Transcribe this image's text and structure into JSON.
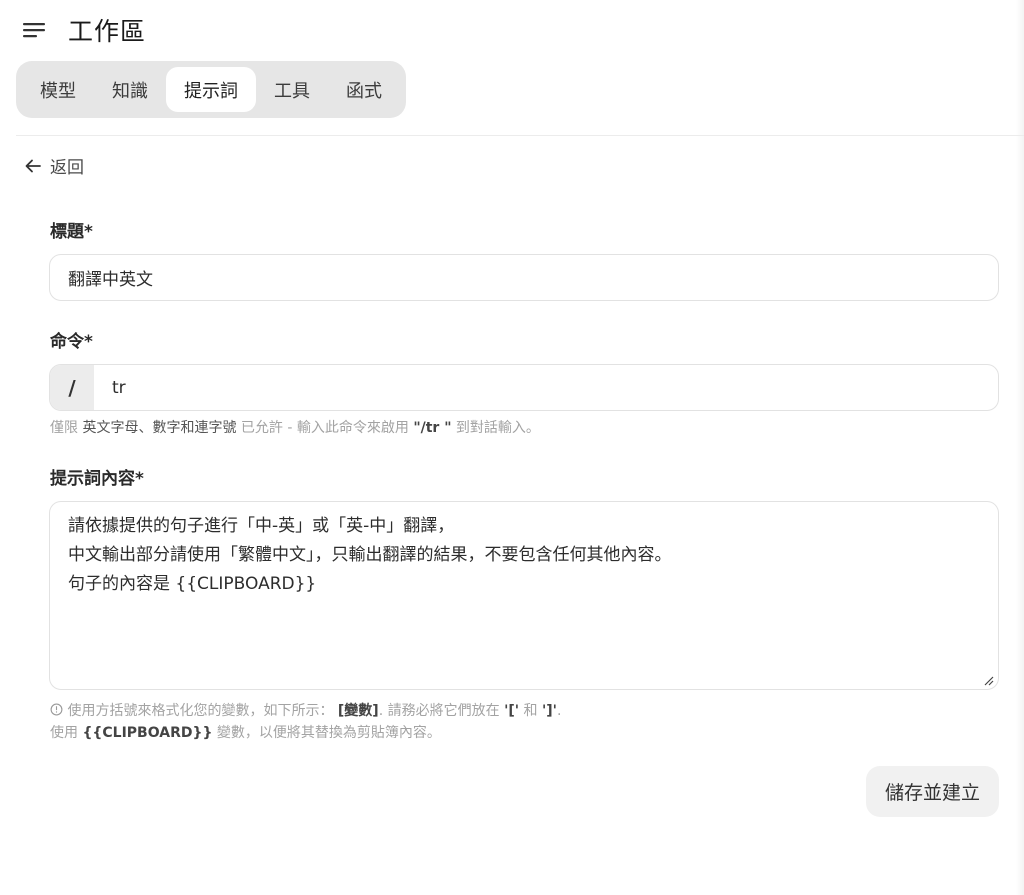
{
  "header": {
    "title": "工作區",
    "menu_icon": "hamburger-menu-icon"
  },
  "tabs": [
    {
      "label": "模型",
      "active": false
    },
    {
      "label": "知識",
      "active": false
    },
    {
      "label": "提示詞",
      "active": true
    },
    {
      "label": "工具",
      "active": false
    },
    {
      "label": "函式",
      "active": false
    }
  ],
  "back": {
    "label": "返回",
    "icon": "arrow-left-icon"
  },
  "form": {
    "title_label": "標題*",
    "title_value": "翻譯中英文",
    "command_label": "命令*",
    "command_prefix": "/",
    "command_value": "tr",
    "command_hint": {
      "p1": "僅限 ",
      "p2": "英文字母、數字和連字號",
      "p3": " 已允許 - 輸入此命令來啟用 ",
      "p4": "\"/tr \"",
      "p5": "  到對話輸入。"
    },
    "content_label": "提示詞內容*",
    "content_lines": [
      "請依據提供的句子進行「中-英」或「英-中」翻譯，",
      "中文輸出部分請使用「繁體中文」，只輸出翻譯的結果，不要包含任何其他內容。",
      "句子的內容是 {{CLIPBOARD}}"
    ],
    "content_hint": {
      "icon": "info-circle-icon",
      "l1a": "使用方括號來格式化您的變數，如下所示： ",
      "l1b": "[變數]",
      "l1c": ". 請務必將它們放在 ",
      "l1d": "'['",
      "l1e": " 和 ",
      "l1f": "']'",
      "l1g": ".",
      "l2a": "使用 ",
      "l2b": "{{CLIPBOARD}}",
      "l2c": " 變數，以便將其替換為剪貼簿內容。"
    }
  },
  "save_button": "儲存並建立"
}
